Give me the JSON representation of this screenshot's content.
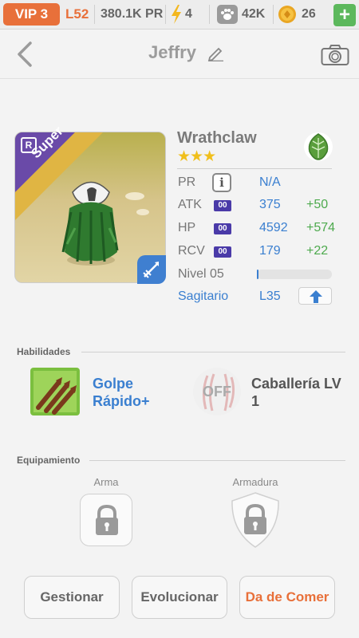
{
  "status_bar": {
    "vip": "VIP 3",
    "level": "L52",
    "pr": "380.1K PR",
    "energy": "4",
    "paw_points": "42K",
    "coins": "26",
    "add_label": "+",
    "bolt_icon": "lightning-bolt-icon",
    "paw_icon": "paw-icon",
    "coin_icon": "coin-icon"
  },
  "header": {
    "title": "Jeffry",
    "back_icon": "chevron-left-icon",
    "edit_icon": "pencil-icon",
    "camera_icon": "camera-icon"
  },
  "character": {
    "name": "Wrathclaw",
    "stars": "★★★",
    "rarity": "Super",
    "rarity_badge": "R",
    "element_icon": "leaf-icon",
    "class_icon": "archer-arrow-icon",
    "stats": [
      {
        "label": "PR",
        "value": "N/A",
        "bonus": ""
      },
      {
        "label": "ATK",
        "value": "375",
        "bonus": "+50",
        "tag": "00"
      },
      {
        "label": "HP",
        "value": "4592",
        "bonus": "+574",
        "tag": "00"
      },
      {
        "label": "RCV",
        "value": "179",
        "bonus": "+22",
        "tag": "00"
      }
    ],
    "level_label": "Nivel 05",
    "exp_progress": 0.02,
    "zodiac": "Sagitario",
    "zodiac_level": "L35"
  },
  "skills": {
    "title": "Habilidades",
    "active": {
      "name": "Golpe Rápido+"
    },
    "passive": {
      "name": "Caballería LV 1",
      "state": "OFF"
    }
  },
  "equipment": {
    "title": "Equipamiento",
    "weapon_label": "Arma",
    "armor_label": "Armadura"
  },
  "actions": {
    "manage": "Gestionar",
    "evolve": "Evolucionar",
    "feed": "Da de Comer"
  },
  "colors": {
    "accent_orange": "#e8703a",
    "link_blue": "#3a7fd0",
    "bonus_green": "#4eaa4e",
    "add_green": "#5cb85c",
    "stat_tag_purple": "#4a3aa8"
  }
}
